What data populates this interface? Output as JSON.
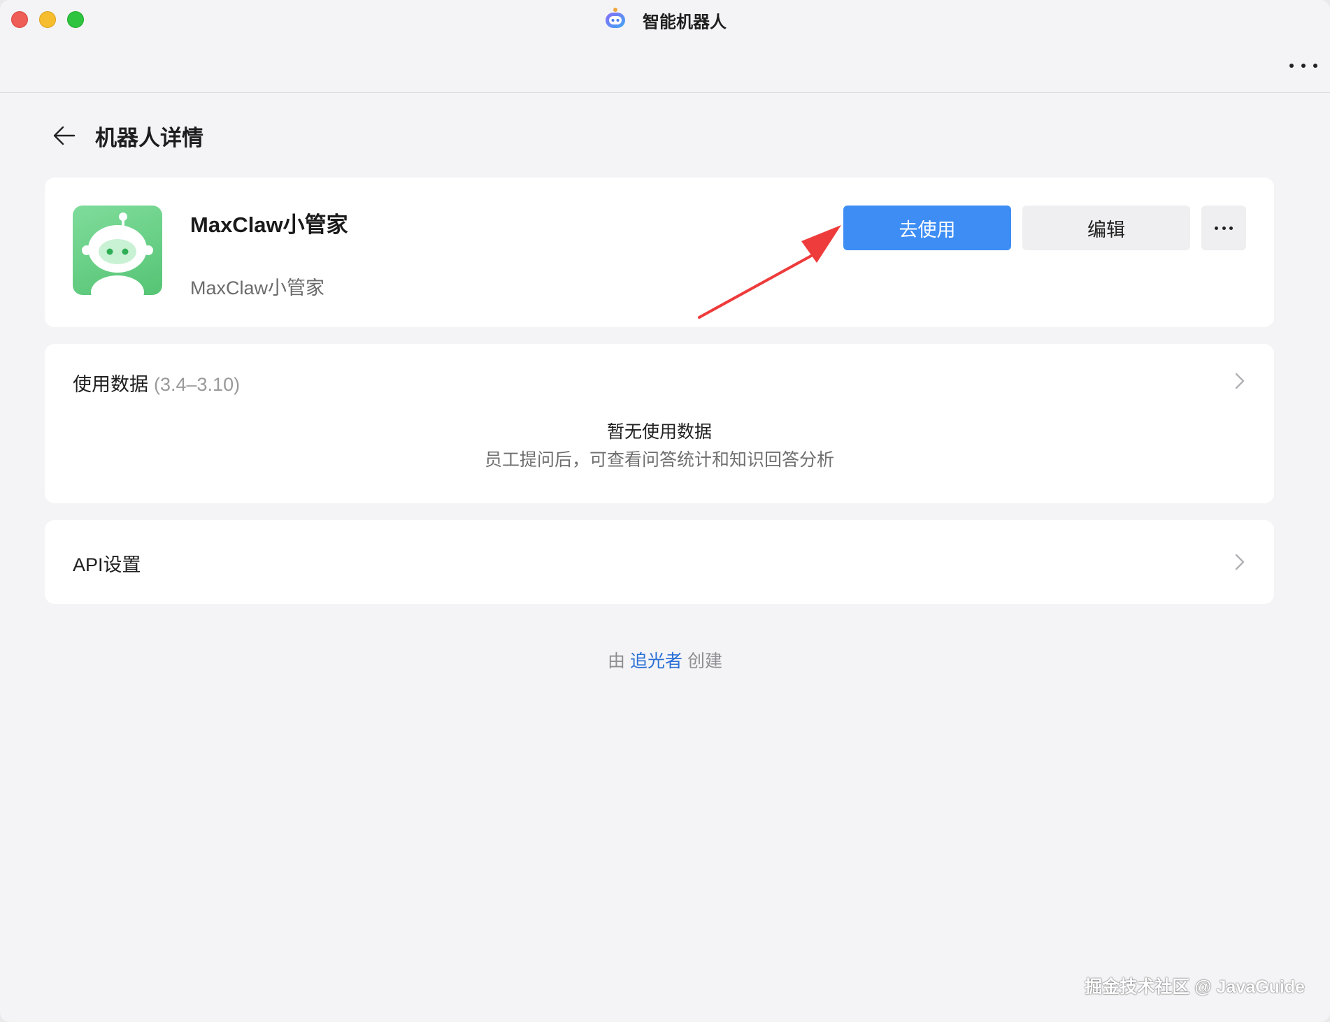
{
  "window": {
    "app_title": "智能机器人"
  },
  "page": {
    "title": "机器人详情"
  },
  "bot": {
    "name": "MaxClaw小管家",
    "description": "MaxClaw小管家"
  },
  "actions": {
    "use_label": "去使用",
    "edit_label": "编辑"
  },
  "usage": {
    "title": "使用数据",
    "range": "(3.4–3.10)",
    "empty_title": "暂无使用数据",
    "empty_subtitle": "员工提问后，可查看问答统计和知识回答分析"
  },
  "api": {
    "title": "API设置"
  },
  "footer": {
    "prefix": "由",
    "creator_name": "追光者",
    "suffix": "创建"
  },
  "watermark": "掘金技术社区 @ JavaGuide",
  "colors": {
    "primary": "#3d8df5",
    "avatar_green": "#6fd18c",
    "annotation_arrow": "#ee3b3b",
    "creator_link": "#2a6fd6"
  }
}
